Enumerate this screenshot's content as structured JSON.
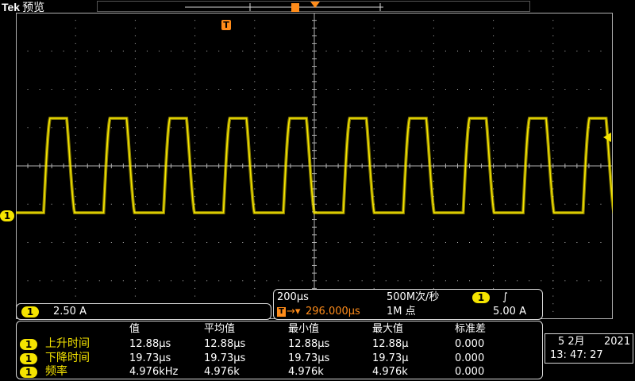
{
  "header": {
    "brand": "Tek",
    "mode": "预览"
  },
  "channel": {
    "number": "1",
    "scale": "2.50 A",
    "color": "#f5e400"
  },
  "trigger_marker": "T",
  "timebase": {
    "time_per_div": "200μs",
    "sample_rate": "500M次/秒",
    "trigger_channel": "1",
    "trigger_slope_icon": "rising-edge",
    "trigger_slope_glyph": "∫",
    "trigger_position": "296.000μs",
    "record_length": "1M 点",
    "trigger_level": "5.00 A"
  },
  "measurements": {
    "headers": [
      "值",
      "平均值",
      "最小值",
      "最大值",
      "标准差"
    ],
    "rows": [
      {
        "channel": "1",
        "name": "上升时间",
        "values": [
          "12.88μs",
          "12.88μs",
          "12.88μs",
          "12.88μ",
          "0.000"
        ]
      },
      {
        "channel": "1",
        "name": "下降时间",
        "values": [
          "19.73μs",
          "19.73μs",
          "19.73μs",
          "19.73μ",
          "0.000"
        ]
      },
      {
        "channel": "1",
        "name": "频率",
        "values": [
          "4.976kHz",
          "4.976k",
          "4.976k",
          "4.976k",
          "0.000"
        ]
      }
    ]
  },
  "datetime": {
    "date": "5 2月",
    "year": "2021",
    "time": "13: 47: 27"
  },
  "colors": {
    "trace": "#f5e400",
    "trigger": "#ff8c1a",
    "grid": "#b0b0b0"
  }
}
